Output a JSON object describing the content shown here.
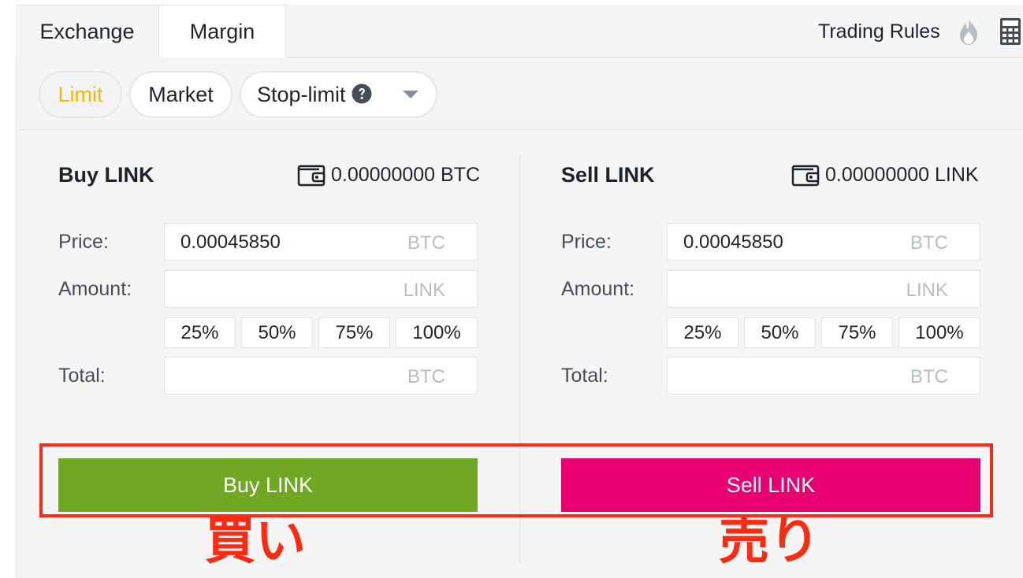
{
  "tabs": [
    {
      "label": "Exchange",
      "active": true
    },
    {
      "label": "Margin",
      "active": false
    }
  ],
  "header": {
    "trading_rules_label": "Trading Rules",
    "icons": [
      "fire-icon",
      "calculator-icon"
    ]
  },
  "order_types": {
    "limit_label": "Limit",
    "market_label": "Market",
    "stop_limit_label": "Stop-limit",
    "active": "Limit",
    "icons": [
      "help-icon",
      "caret-down-icon"
    ]
  },
  "buy_form": {
    "title": "Buy LINK",
    "balance": "0.00000000 BTC",
    "price_label": "Price:",
    "price_value": "0.00045850",
    "price_unit": "BTC",
    "amount_label": "Amount:",
    "amount_value": "",
    "amount_unit": "LINK",
    "percentages": [
      "25%",
      "50%",
      "75%",
      "100%"
    ],
    "total_label": "Total:",
    "total_value": "",
    "total_unit": "BTC",
    "button_label": "Buy LINK"
  },
  "sell_form": {
    "title": "Sell LINK",
    "balance": "0.00000000 LINK",
    "price_label": "Price:",
    "price_value": "0.00045850",
    "price_unit": "BTC",
    "amount_label": "Amount:",
    "amount_value": "",
    "amount_unit": "LINK",
    "percentages": [
      "25%",
      "50%",
      "75%",
      "100%"
    ],
    "total_label": "Total:",
    "total_value": "",
    "total_unit": "BTC",
    "button_label": "Sell LINK"
  },
  "annotations": {
    "buy_text": "買い",
    "sell_text": "売り",
    "color": "#ff2a10"
  },
  "colors": {
    "buy": "#70a723",
    "sell": "#e80070",
    "accent": "#f0b90b"
  }
}
